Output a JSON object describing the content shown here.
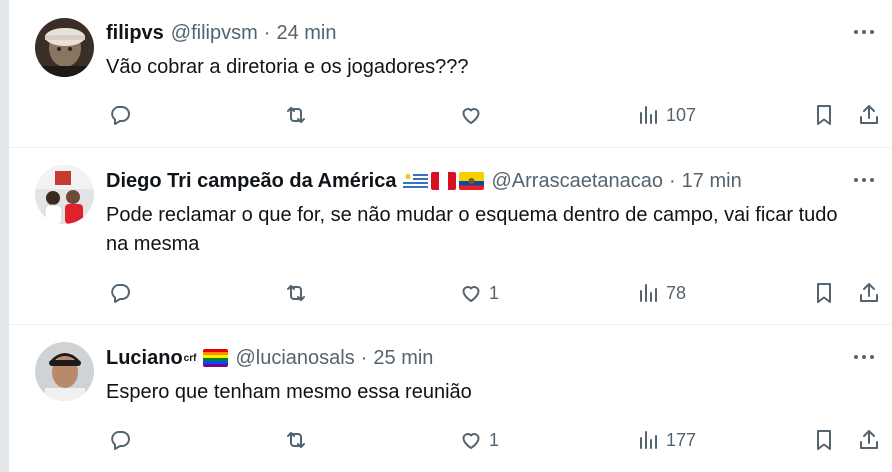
{
  "tweets": [
    {
      "display_name": "filipvs",
      "handle": "@filipvsm",
      "time": "24 min",
      "text": "Vão cobrar a diretoria e os jogadores???",
      "likes": "",
      "views": "107"
    },
    {
      "display_name": "Diego Tri campeão da América",
      "handle": "@Arrascaetanacao",
      "time": "17 min",
      "text": "Pode reclamar o que for, se não mudar o esquema dentro de campo, vai ficar tudo na mesma",
      "likes": "1",
      "views": "78"
    },
    {
      "display_name": "Luciano",
      "name_superscript": "crf",
      "handle": "@lucianosals",
      "time": "25 min",
      "text": "Espero que tenham mesmo essa reunião",
      "likes": "1",
      "views": "177"
    }
  ],
  "separator": "·",
  "icons": {
    "reply": "reply-icon",
    "retweet": "retweet-icon",
    "like": "heart-icon",
    "views": "views-chart-icon",
    "bookmark": "bookmark-icon",
    "share": "share-icon",
    "more": "more-dots-icon"
  },
  "colors": {
    "text_primary": "#0f1419",
    "text_secondary": "#536471",
    "divider": "#eff3f4"
  }
}
